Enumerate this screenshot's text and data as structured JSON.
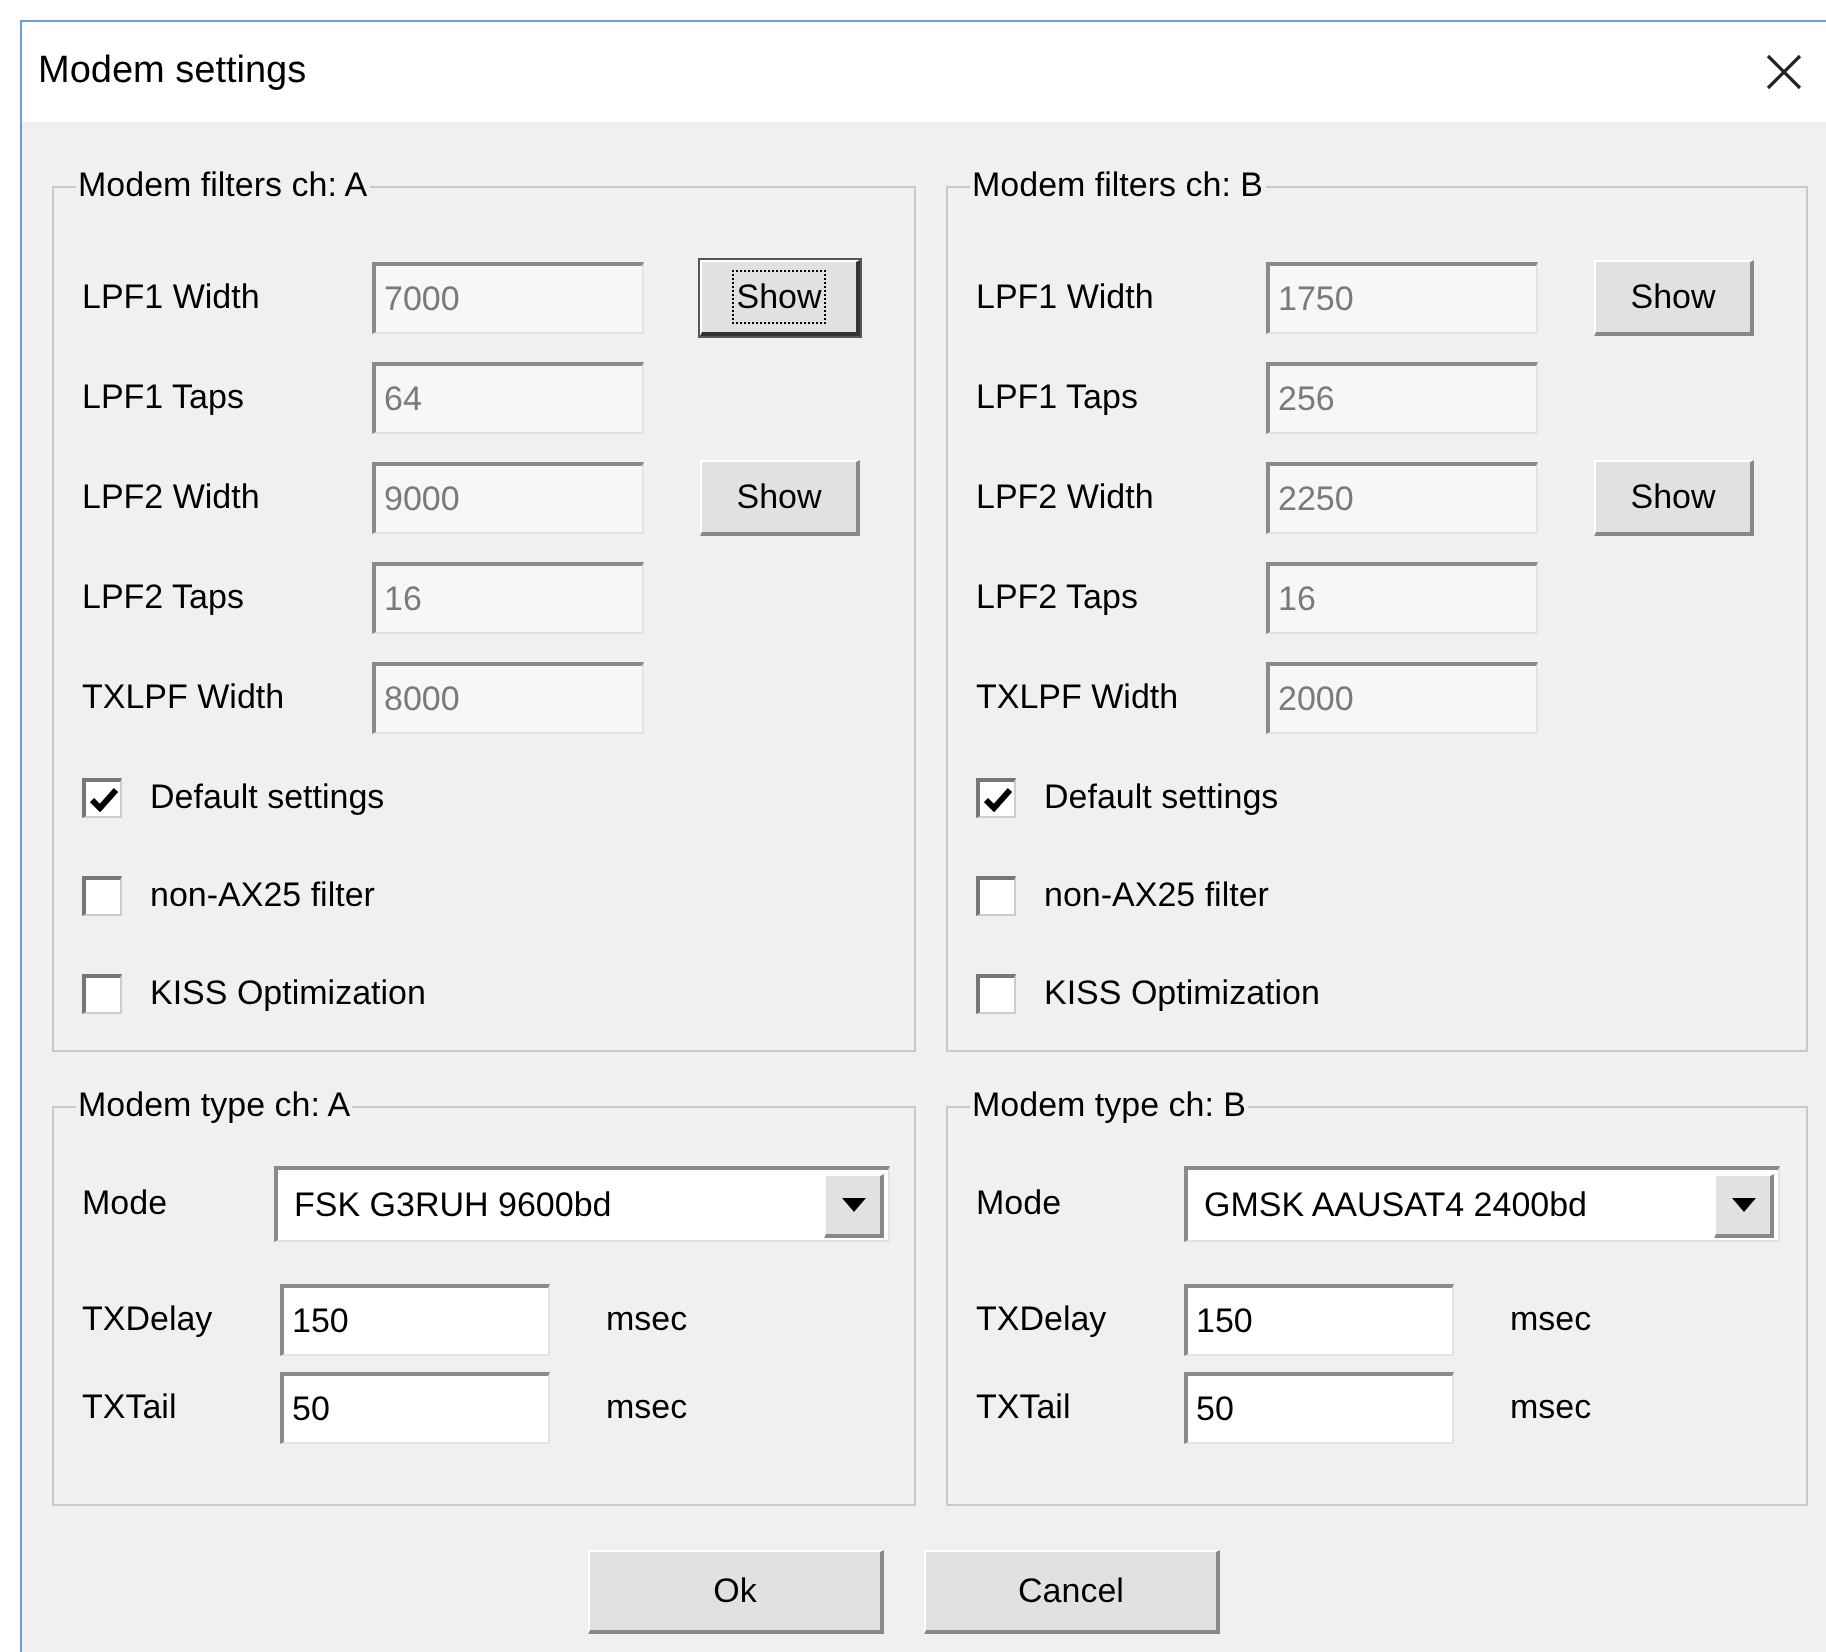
{
  "window": {
    "title": "Modem settings"
  },
  "filter_groups": [
    {
      "title": "Modem filters ch: A",
      "fields": [
        {
          "label": "LPF1 Width",
          "value": "7000",
          "disabled": true,
          "show_button": {
            "label": "Show",
            "focused": true
          }
        },
        {
          "label": "LPF1 Taps",
          "value": "64",
          "disabled": true
        },
        {
          "label": "LPF2 Width",
          "value": "9000",
          "disabled": true,
          "show_button": {
            "label": "Show",
            "focused": false
          }
        },
        {
          "label": "LPF2 Taps",
          "value": "16",
          "disabled": true
        },
        {
          "label": "TXLPF Width",
          "value": "8000",
          "disabled": true
        }
      ],
      "options": [
        {
          "label": "Default settings",
          "checked": true
        },
        {
          "label": "non-AX25 filter",
          "checked": false
        },
        {
          "label": "KISS Optimization",
          "checked": false
        }
      ]
    },
    {
      "title": "Modem filters ch: B",
      "fields": [
        {
          "label": "LPF1 Width",
          "value": "1750",
          "disabled": true,
          "show_button": {
            "label": "Show",
            "focused": false
          }
        },
        {
          "label": "LPF1 Taps",
          "value": "256",
          "disabled": true
        },
        {
          "label": "LPF2 Width",
          "value": "2250",
          "disabled": true,
          "show_button": {
            "label": "Show",
            "focused": false
          }
        },
        {
          "label": "LPF2 Taps",
          "value": "16",
          "disabled": true
        },
        {
          "label": "TXLPF Width",
          "value": "2000",
          "disabled": true
        }
      ],
      "options": [
        {
          "label": "Default settings",
          "checked": true
        },
        {
          "label": "non-AX25 filter",
          "checked": false
        },
        {
          "label": "KISS Optimization",
          "checked": false
        }
      ]
    }
  ],
  "type_groups": [
    {
      "title": "Modem type ch: A",
      "mode": {
        "label": "Mode",
        "value": "FSK G3RUH 9600bd"
      },
      "timings": [
        {
          "label": "TXDelay",
          "value": "150",
          "unit": "msec"
        },
        {
          "label": "TXTail",
          "value": "50",
          "unit": "msec"
        }
      ]
    },
    {
      "title": "Modem type ch: B",
      "mode": {
        "label": "Mode",
        "value": "GMSK AAUSAT4 2400bd"
      },
      "timings": [
        {
          "label": "TXDelay",
          "value": "150",
          "unit": "msec"
        },
        {
          "label": "TXTail",
          "value": "50",
          "unit": "msec"
        }
      ]
    }
  ],
  "buttons": [
    {
      "label": "Ok"
    },
    {
      "label": "Cancel"
    }
  ]
}
